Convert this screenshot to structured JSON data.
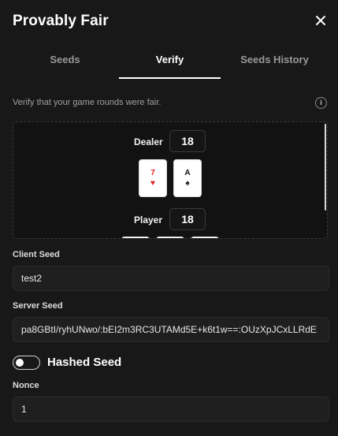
{
  "header": {
    "title": "Provably Fair"
  },
  "tabs": [
    {
      "label": "Seeds"
    },
    {
      "label": "Verify"
    },
    {
      "label": "Seeds History"
    }
  ],
  "active_tab": "Verify",
  "description": "Verify that your game rounds were fair.",
  "info_glyph": "i",
  "preview": {
    "dealer": {
      "label": "Dealer",
      "score": "18",
      "cards": [
        {
          "rank": "7",
          "suit": "♥",
          "color": "#e02020"
        },
        {
          "rank": "A",
          "suit": "♠",
          "color": "#111111"
        }
      ]
    },
    "player": {
      "label": "Player",
      "score": "18"
    }
  },
  "client_seed": {
    "label": "Client Seed",
    "value": "test2"
  },
  "server_seed": {
    "label": "Server Seed",
    "value": "pa8GBtI/ryhUNwo/:bEI2m3RC3UTAMd5E+k6t1w==:OUzXpJCxLLRdE"
  },
  "hashed_seed": {
    "label": "Hashed Seed",
    "enabled": false
  },
  "nonce": {
    "label": "Nonce",
    "value": "1"
  },
  "colors": {
    "background": "#181818",
    "card_red": "#e02020",
    "accent": "#ffffff"
  }
}
